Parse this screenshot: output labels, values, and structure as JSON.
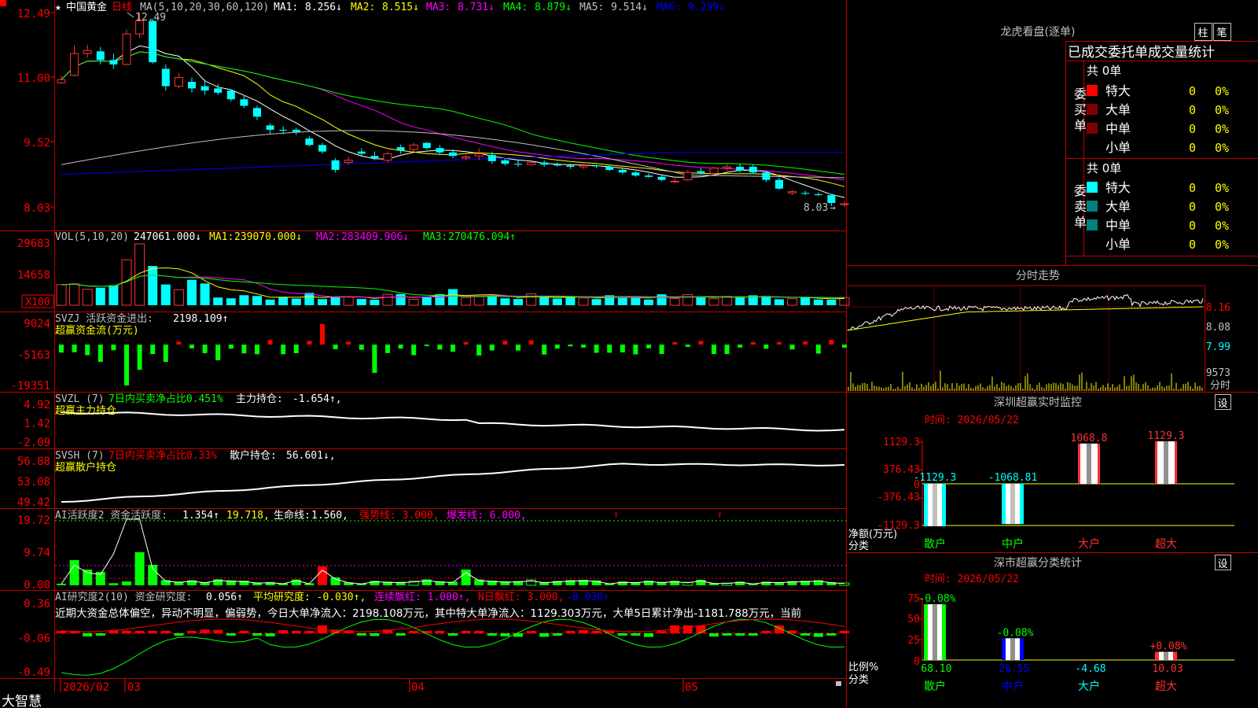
{
  "stock": {
    "name": "中国黄金",
    "period": "日线"
  },
  "kline": {
    "ma_header": "MA(5,10,20,30,60,120)",
    "ma_labels": [
      "MA1:",
      "MA2:",
      "MA3:",
      "MA4:",
      "MA5:",
      "MA6:"
    ],
    "ma_values": [
      "8.256↓",
      "8.515↓",
      "8.731↓",
      "8.879↓",
      "9.514↓",
      "9.299↓"
    ],
    "ma_colors": [
      "#ffffff",
      "#ffff00",
      "#ff00ff",
      "#00ff00",
      "#c0c0c0",
      "#0000ff"
    ],
    "y_labels": [
      "12.49",
      "11.00",
      "9.52",
      "8.03"
    ],
    "high_label": "12.49",
    "low_label": "8.03",
    "candles": [
      [
        10.88,
        11.05,
        10.85,
        10.95
      ],
      [
        11.05,
        11.75,
        11.02,
        11.55
      ],
      [
        11.55,
        11.75,
        11.45,
        11.62
      ],
      [
        11.6,
        11.7,
        11.3,
        11.4
      ],
      [
        11.4,
        11.55,
        11.2,
        11.3
      ],
      [
        11.3,
        12.1,
        11.28,
        12.0
      ],
      [
        12.0,
        12.49,
        11.9,
        12.3
      ],
      [
        12.3,
        12.35,
        11.32,
        11.35
      ],
      [
        11.2,
        11.3,
        10.7,
        10.8
      ],
      [
        10.8,
        11.1,
        10.75,
        11.0
      ],
      [
        10.9,
        11.0,
        10.65,
        10.75
      ],
      [
        10.8,
        10.95,
        10.6,
        10.7
      ],
      [
        10.75,
        10.85,
        10.6,
        10.65
      ],
      [
        10.7,
        10.72,
        10.45,
        10.5
      ],
      [
        10.5,
        10.6,
        10.3,
        10.35
      ],
      [
        10.3,
        10.35,
        10.02,
        10.1
      ],
      [
        9.9,
        9.95,
        9.7,
        9.8
      ],
      [
        9.8,
        9.88,
        9.7,
        9.78
      ],
      [
        9.8,
        9.85,
        9.68,
        9.75
      ],
      [
        9.6,
        9.65,
        9.42,
        9.45
      ],
      [
        9.45,
        9.5,
        9.25,
        9.3
      ],
      [
        9.1,
        9.15,
        8.82,
        8.88
      ],
      [
        9.05,
        9.18,
        9.0,
        9.1
      ],
      [
        9.3,
        9.38,
        9.2,
        9.25
      ],
      [
        9.2,
        9.3,
        9.1,
        9.15
      ],
      [
        9.1,
        9.3,
        9.05,
        9.25
      ],
      [
        9.4,
        9.46,
        9.25,
        9.32
      ],
      [
        9.35,
        9.5,
        9.3,
        9.45
      ],
      [
        9.5,
        9.52,
        9.35,
        9.38
      ],
      [
        9.38,
        9.45,
        9.22,
        9.28
      ],
      [
        9.28,
        9.35,
        9.15,
        9.2
      ],
      [
        9.15,
        9.22,
        9.1,
        9.18
      ],
      [
        9.2,
        9.38,
        9.1,
        9.25
      ],
      [
        9.22,
        9.3,
        9.02,
        9.08
      ],
      [
        9.1,
        9.15,
        8.98,
        9.02
      ],
      [
        9.02,
        9.1,
        8.95,
        9.0
      ],
      [
        9.0,
        9.08,
        8.98,
        9.05
      ],
      [
        9.05,
        9.1,
        8.95,
        9.0
      ],
      [
        9.0,
        9.05,
        8.95,
        8.98
      ],
      [
        8.98,
        9.02,
        8.9,
        8.95
      ],
      [
        8.95,
        9.02,
        8.9,
        8.98
      ],
      [
        8.98,
        9.0,
        8.92,
        8.96
      ],
      [
        8.95,
        9.0,
        8.85,
        8.88
      ],
      [
        8.88,
        8.92,
        8.78,
        8.82
      ],
      [
        8.82,
        8.85,
        8.72,
        8.75
      ],
      [
        8.75,
        8.8,
        8.7,
        8.72
      ],
      [
        8.72,
        8.75,
        8.62,
        8.65
      ],
      [
        8.62,
        8.68,
        8.58,
        8.62
      ],
      [
        8.65,
        8.88,
        8.62,
        8.82
      ],
      [
        8.85,
        8.92,
        8.78,
        8.8
      ],
      [
        8.8,
        8.95,
        8.78,
        8.92
      ],
      [
        8.92,
        9.0,
        8.85,
        8.95
      ],
      [
        8.95,
        9.02,
        8.82,
        8.86
      ],
      [
        8.95,
        9.0,
        8.78,
        8.82
      ],
      [
        8.82,
        8.85,
        8.6,
        8.65
      ],
      [
        8.65,
        8.7,
        8.42,
        8.45
      ],
      [
        8.35,
        8.42,
        8.3,
        8.38
      ],
      [
        8.35,
        8.4,
        8.3,
        8.33
      ],
      [
        8.32,
        8.36,
        8.28,
        8.3
      ],
      [
        8.3,
        8.32,
        8.05,
        8.12
      ],
      [
        8.08,
        8.15,
        8.03,
        8.1
      ]
    ]
  },
  "vol": {
    "header": "VOL(5,10,20)",
    "value": "247061.000↓",
    "ma_labels": [
      "MA1:",
      "MA2:",
      "MA3:"
    ],
    "ma_values": [
      "239070.000↓",
      "283409.906↓",
      "270476.094↑"
    ],
    "ma_colors": [
      "#ffff00",
      "#ff00ff",
      "#00ff00"
    ],
    "y_labels": [
      "29683",
      "14658",
      "X100"
    ]
  },
  "svzj": {
    "header": "SVZJ  活跃资金进出:",
    "value": "2198.109↑",
    "subtitle": "超赢资金流(万元)",
    "y_labels": [
      "9024",
      "-5163",
      "-19351"
    ]
  },
  "svzl": {
    "header": "SVZL (7)",
    "ratio": "7日内买卖净占比0.451%",
    "label": "主力持仓:",
    "value": "-1.654↑,",
    "subtitle": "超赢主力持仓",
    "y_labels": [
      "4.92",
      "1.42",
      "-2.09"
    ]
  },
  "svsh": {
    "header": "SVSH (7)",
    "ratio": "7日内买卖净占比0.33%",
    "label": "散户持仓:",
    "value": "56.601↓,",
    "subtitle": "超赢散户持仓",
    "y_labels": [
      "56.88",
      "53.08",
      "49.42"
    ]
  },
  "ai1": {
    "header": "AI活跃度2 资金活跃度:",
    "v1": "1.354↑",
    "v2": "19.718,",
    "life_label": "生命线:",
    "life_value": "1.560,",
    "strong": "强势线: 3.000,",
    "burst": "爆发线: 6.000,",
    "y_labels": [
      "19.72",
      "9.74",
      "0.00"
    ]
  },
  "ai2": {
    "header": "AI研究度2(10) 资金研究度:",
    "v1": "0.056↑",
    "avg": "平均研究度: -0.030↑,",
    "cont": "连续飘红: 1.000↑,",
    "nday": "N日飘红: 3.000,",
    "last": "-0.030↑",
    "summary": "近期大资金总体偏空，异动不明显，偏弱势，今日大单净流入：2198.108万元，其中特大单净流入：1129.303万元，大单5日累计净出-1181.788万元，当前",
    "y_labels": [
      "0.36",
      "-0.06",
      "-0.49"
    ]
  },
  "dates": [
    "2026/02",
    "03",
    "04",
    "05"
  ],
  "brand": "大智慧",
  "longhu": {
    "title": "龙虎看盘(逐单)",
    "tab1": "柱",
    "tab2": "笔",
    "header": "已成交委托单成交量统计",
    "buy_label": "委买单",
    "sell_label": "委卖单",
    "buy_total": "共 0单",
    "sell_total": "共 0单",
    "rows": [
      {
        "label": "特大",
        "vol": "0",
        "pct": "0%"
      },
      {
        "label": "大单",
        "vol": "0",
        "pct": "0%"
      },
      {
        "label": "中单",
        "vol": "0",
        "pct": "0%"
      },
      {
        "label": "小单",
        "vol": "0",
        "pct": "0%"
      }
    ],
    "buy_colors": [
      "#ff0000",
      "#800000",
      "#800000",
      ""
    ],
    "sell_colors": [
      "#00ffff",
      "#008080",
      "#008080",
      ""
    ]
  },
  "intraday": {
    "title": "分时走势",
    "y_labels": [
      "8.16",
      "8.08",
      "7.99"
    ],
    "vol_label": "9573",
    "unit": "分时"
  },
  "monitor": {
    "title": "深圳超赢实时监控",
    "set": "设",
    "time": "时间: 2026/05/22",
    "y_labels": [
      "1129.3",
      "376.43",
      "0",
      "-376.43",
      "-1129.3"
    ],
    "unit": "净额(万元)",
    "cat_label": "分类",
    "categories": [
      "散户",
      "中户",
      "大户",
      "超大"
    ],
    "values": [
      -1129.3,
      -1068.81,
      1068.8,
      1129.3
    ],
    "value_labels": [
      "-1129.3",
      "-1068.81",
      "1068.8",
      "1129.3"
    ]
  },
  "classify": {
    "title": "深市超赢分类统计",
    "set": "设",
    "time": "时间: 2026/05/22",
    "y_labels": [
      "75",
      "50",
      "25",
      "0"
    ],
    "unit": "比例%",
    "cat_label": "分类",
    "categories": [
      "散户",
      "中户",
      "大户",
      "超大"
    ],
    "values": [
      68.1,
      26.55,
      -4.68,
      10.03
    ],
    "value_labels": [
      "68.10",
      "26.55",
      "-4.68",
      "10.03"
    ],
    "change_labels": [
      "-0.08%",
      "-0.08%",
      "",
      "+0.08%"
    ]
  }
}
